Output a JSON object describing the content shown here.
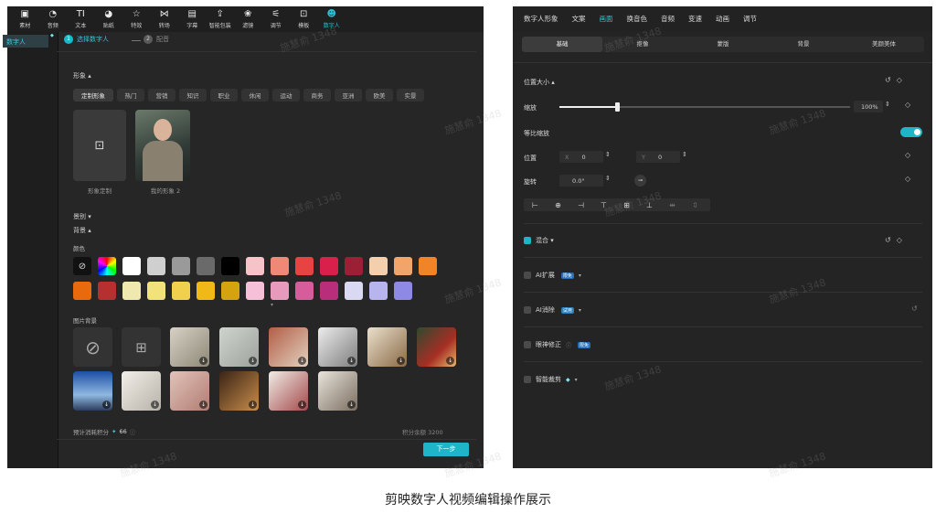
{
  "toolbar": {
    "items": [
      {
        "label": "素材",
        "icon": "▣"
      },
      {
        "label": "音频",
        "icon": "◔"
      },
      {
        "label": "文本",
        "icon": "TI"
      },
      {
        "label": "贴纸",
        "icon": "◕"
      },
      {
        "label": "特效",
        "icon": "☆"
      },
      {
        "label": "转场",
        "icon": "⋈"
      },
      {
        "label": "字幕",
        "icon": "▤"
      },
      {
        "label": "智能包装",
        "icon": "⇪"
      },
      {
        "label": "滤镜",
        "icon": "❀"
      },
      {
        "label": "调节",
        "icon": "⚟"
      },
      {
        "label": "模板",
        "icon": "⊡"
      },
      {
        "label": "数字人",
        "icon": "☻"
      }
    ]
  },
  "sidebar": {
    "item": "数字人",
    "badge": "◆"
  },
  "steps": {
    "step1_num": "1",
    "step1": "选择数字人",
    "step2_num": "2",
    "step2": "配音"
  },
  "appearance": {
    "title": "形象 ▴",
    "chips": [
      "定制形象",
      "热门",
      "营销",
      "知识",
      "职业",
      "休闲",
      "运动",
      "商务",
      "亚洲",
      "欧美",
      "实景"
    ],
    "custom_label": "形象定制",
    "my_label": "我的形象 2"
  },
  "scene": {
    "title": "景别 ▾",
    "bg_title": "背景 ▴",
    "color_label": "颜色",
    "image_bg_label": "图片背景",
    "more": "▾"
  },
  "colors": {
    "row1": [
      "#ff0000",
      "#ffffff",
      "#cfcfcf",
      "#9a9a9a",
      "#6a6a6a",
      "#000000",
      "#f6c3c8",
      "#f08878",
      "#e84343",
      "#d91f4c",
      "#9c1f36",
      "#f3cfae",
      "#f2a56a",
      "#f08427"
    ],
    "row2": [
      "#e86a0d",
      "#b63030",
      "#efe9b0",
      "#f1e27a",
      "#f0d04d",
      "#f0b917",
      "#d4a30f",
      "#f6c0d8",
      "#e79abc",
      "#d75c9b",
      "#b92e7b",
      "#d9d9f4",
      "#b7b4ee",
      "#8f89e6"
    ]
  },
  "footer": {
    "cost_label": "预计消耗积分",
    "cost_icon": "✦",
    "cost": "66",
    "balance": "积分余额 3200",
    "next": "下一步"
  },
  "rtabs": [
    "数字人形象",
    "文案",
    "画面",
    "换音色",
    "音频",
    "变速",
    "动画",
    "调节"
  ],
  "subtabs": [
    "基础",
    "抠像",
    "蒙版",
    "背景",
    "美颜美体"
  ],
  "props": {
    "size_title": "位置大小 ▴",
    "scale_label": "缩放",
    "scale_value": "100%",
    "scale_fraction": 0.15,
    "uniform_label": "等比缩放",
    "pos_label": "位置",
    "x_label": "X",
    "x_value": "0",
    "y_label": "Y",
    "y_value": "0",
    "rotate_label": "旋转",
    "rotate_value": "0.0°",
    "blend_label": "混合 ▾",
    "ai_expand": "AI扩展",
    "ai_remove": "AI消除",
    "eye_fix": "眼神修正",
    "smart_crop": "智能裁剪",
    "tag_free": "限免",
    "tag_trial": "试用",
    "reset": "↺",
    "kf": "◇"
  },
  "align_icons": [
    "⊢",
    "⊕",
    "⊣",
    "⊤",
    "⊞",
    "⊥",
    "⇹",
    "⇳"
  ],
  "caption": "剪映数字人视频编辑操作展示",
  "watermark": "施慧俞 1348"
}
